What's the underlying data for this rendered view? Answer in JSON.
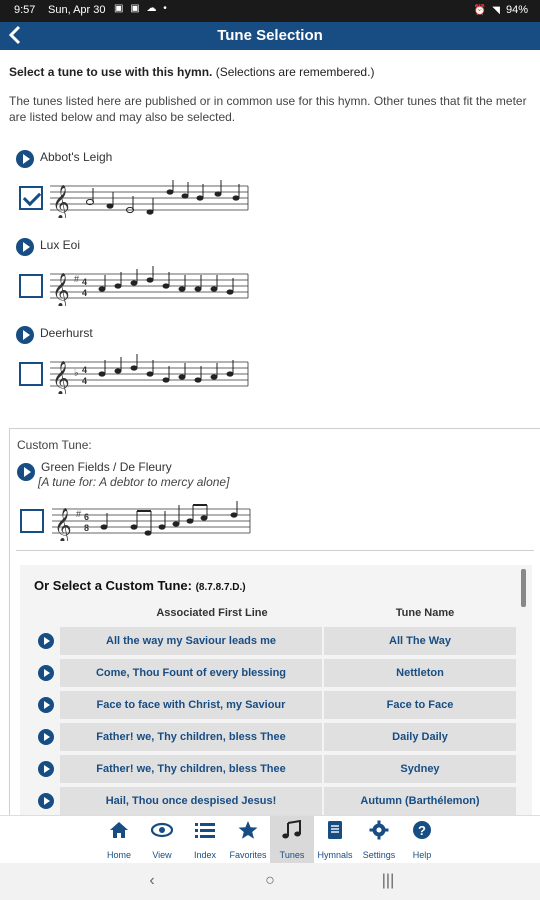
{
  "status": {
    "time": "9:57",
    "date": "Sun, Apr 30",
    "battery": "94%"
  },
  "header": {
    "title": "Tune Selection"
  },
  "intro": {
    "bold": "Select a tune to use with this hymn.",
    "note": " (Selections are remembered.)",
    "desc": "The tunes listed here are published or in common use for this hymn. Other tunes that fit the meter are listed below and may also be selected."
  },
  "tunes": [
    {
      "name": "Abbot's Leigh",
      "checked": true
    },
    {
      "name": "Lux Eoi",
      "checked": false
    },
    {
      "name": "Deerhurst",
      "checked": false
    }
  ],
  "custom": {
    "label": "Custom Tune:",
    "name": "Green Fields / De Fleury",
    "sub": "[A tune for: A debtor to mercy alone]",
    "select_head": "Or Select a Custom Tune:",
    "meter": "(8.7.8.7.D.)",
    "col1": "Associated First Line",
    "col2": "Tune Name",
    "rows": [
      {
        "line": "All the way my Saviour leads me",
        "tune": "All The Way"
      },
      {
        "line": "Come, Thou Fount of every blessing",
        "tune": "Nettleton"
      },
      {
        "line": "Face to face with Christ, my Saviour",
        "tune": "Face to Face"
      },
      {
        "line": "Father! we, Thy children, bless Thee",
        "tune": "Daily Daily"
      },
      {
        "line": "Father! we, Thy children, bless Thee",
        "tune": "Sydney"
      },
      {
        "line": "Hail, Thou once despised Jesus!",
        "tune": "Autumn (Barthélemon)"
      }
    ]
  },
  "nav": [
    {
      "label": "Home",
      "icon": "home-icon"
    },
    {
      "label": "View",
      "icon": "eye-icon"
    },
    {
      "label": "Index",
      "icon": "list-icon"
    },
    {
      "label": "Favorites",
      "icon": "star-icon"
    },
    {
      "label": "Tunes",
      "icon": "music-note-icon",
      "active": true
    },
    {
      "label": "Hymnals",
      "icon": "book-icon"
    },
    {
      "label": "Settings",
      "icon": "gear-icon"
    },
    {
      "label": "Help",
      "icon": "help-icon"
    }
  ],
  "colors": {
    "primary": "#184d84",
    "row_bg": "#e0e0e0"
  }
}
